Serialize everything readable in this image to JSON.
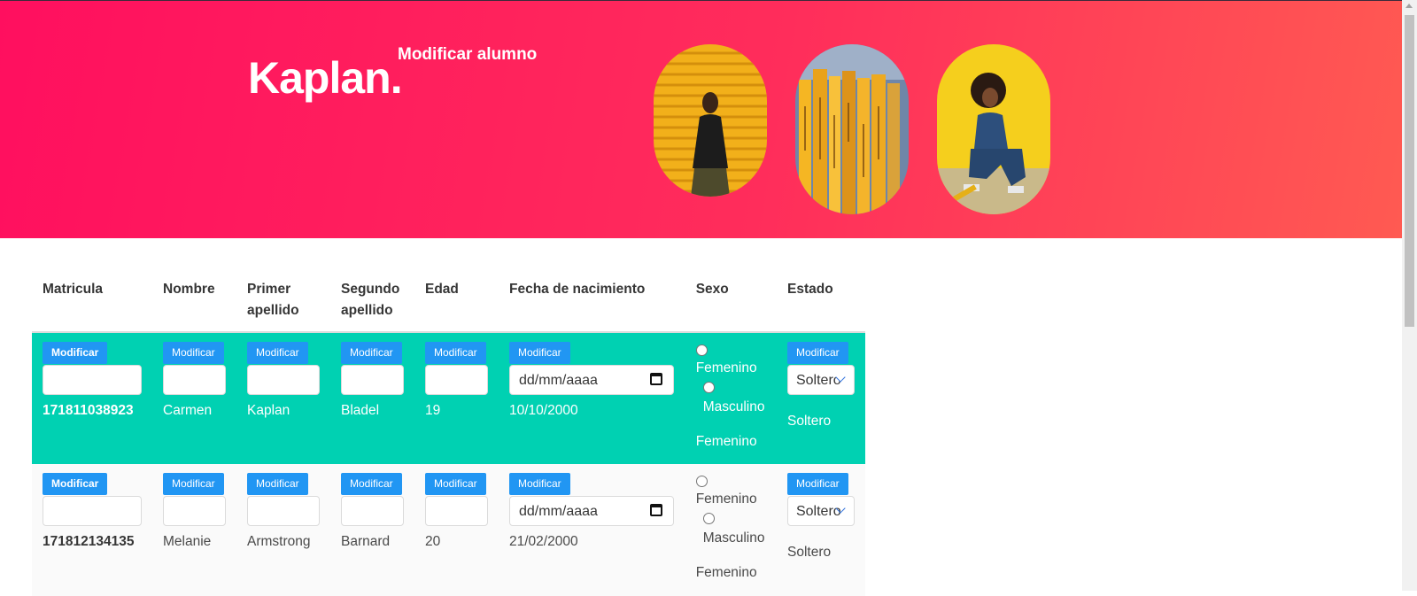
{
  "header": {
    "brand": "Kaplan.",
    "subtitle": "Modificar alumno"
  },
  "images": [
    {
      "name": "woman-yellow-wall-photo"
    },
    {
      "name": "yellow-books-photo"
    },
    {
      "name": "woman-crouching-photo"
    }
  ],
  "table": {
    "columns": [
      "Matricula",
      "Nombre",
      "Primer apellido",
      "Segundo apellido",
      "Edad",
      "Fecha de nacimiento",
      "Sexo",
      "Estado"
    ],
    "modify_label": "Modificar",
    "date_placeholder": "dd/mm/aaaa",
    "radio_labels": {
      "female": "Femenino",
      "male": "Masculino"
    },
    "select_value": "Soltero",
    "rows": [
      {
        "matricula": "171811038923",
        "nombre": "Carmen",
        "primer_apellido": "Kaplan",
        "segundo_apellido": "Bladel",
        "edad": "19",
        "fecha": "10/10/2000",
        "sexo": "Femenino",
        "estado": "Soltero"
      },
      {
        "matricula": "171812134135",
        "nombre": "Melanie",
        "primer_apellido": "Armstrong",
        "segundo_apellido": "Barnard",
        "edad": "20",
        "fecha": "21/02/2000",
        "sexo": "Femenino",
        "estado": "Soltero"
      }
    ]
  },
  "colors": {
    "hero_start": "#ff0f5f",
    "hero_end": "#ff5a52",
    "selected_row": "#00d1b2",
    "button": "#2196f3"
  }
}
